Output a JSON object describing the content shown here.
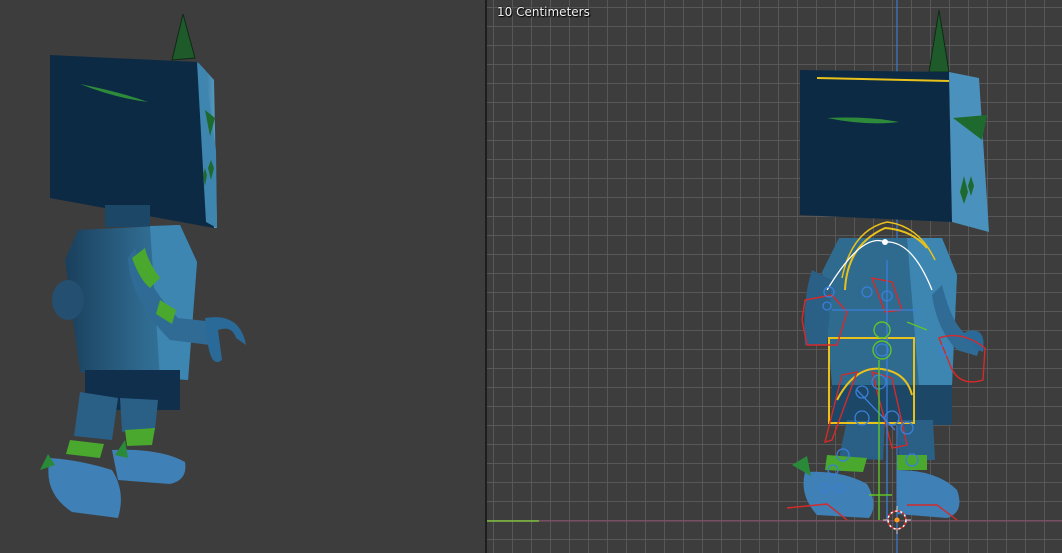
{
  "viewport_right": {
    "scale_label": "10 Centimeters"
  },
  "colors": {
    "viewport_bg": "#3d3d3d",
    "grid_line": "#5c5c5c",
    "x_axis": "#7fbf3f",
    "z_axis": "#3f7fdf",
    "bone_yellow": "#e8c21a",
    "bone_red": "#d42a2a",
    "bone_blue": "#3a7fd9",
    "bone_green": "#5ec428",
    "model_dark": "#0d2a45",
    "model_light": "#3f88b4",
    "accent_green": "#49a82d"
  },
  "icons": {
    "cursor": "3d-cursor-icon",
    "origin": "object-origin-icon"
  }
}
